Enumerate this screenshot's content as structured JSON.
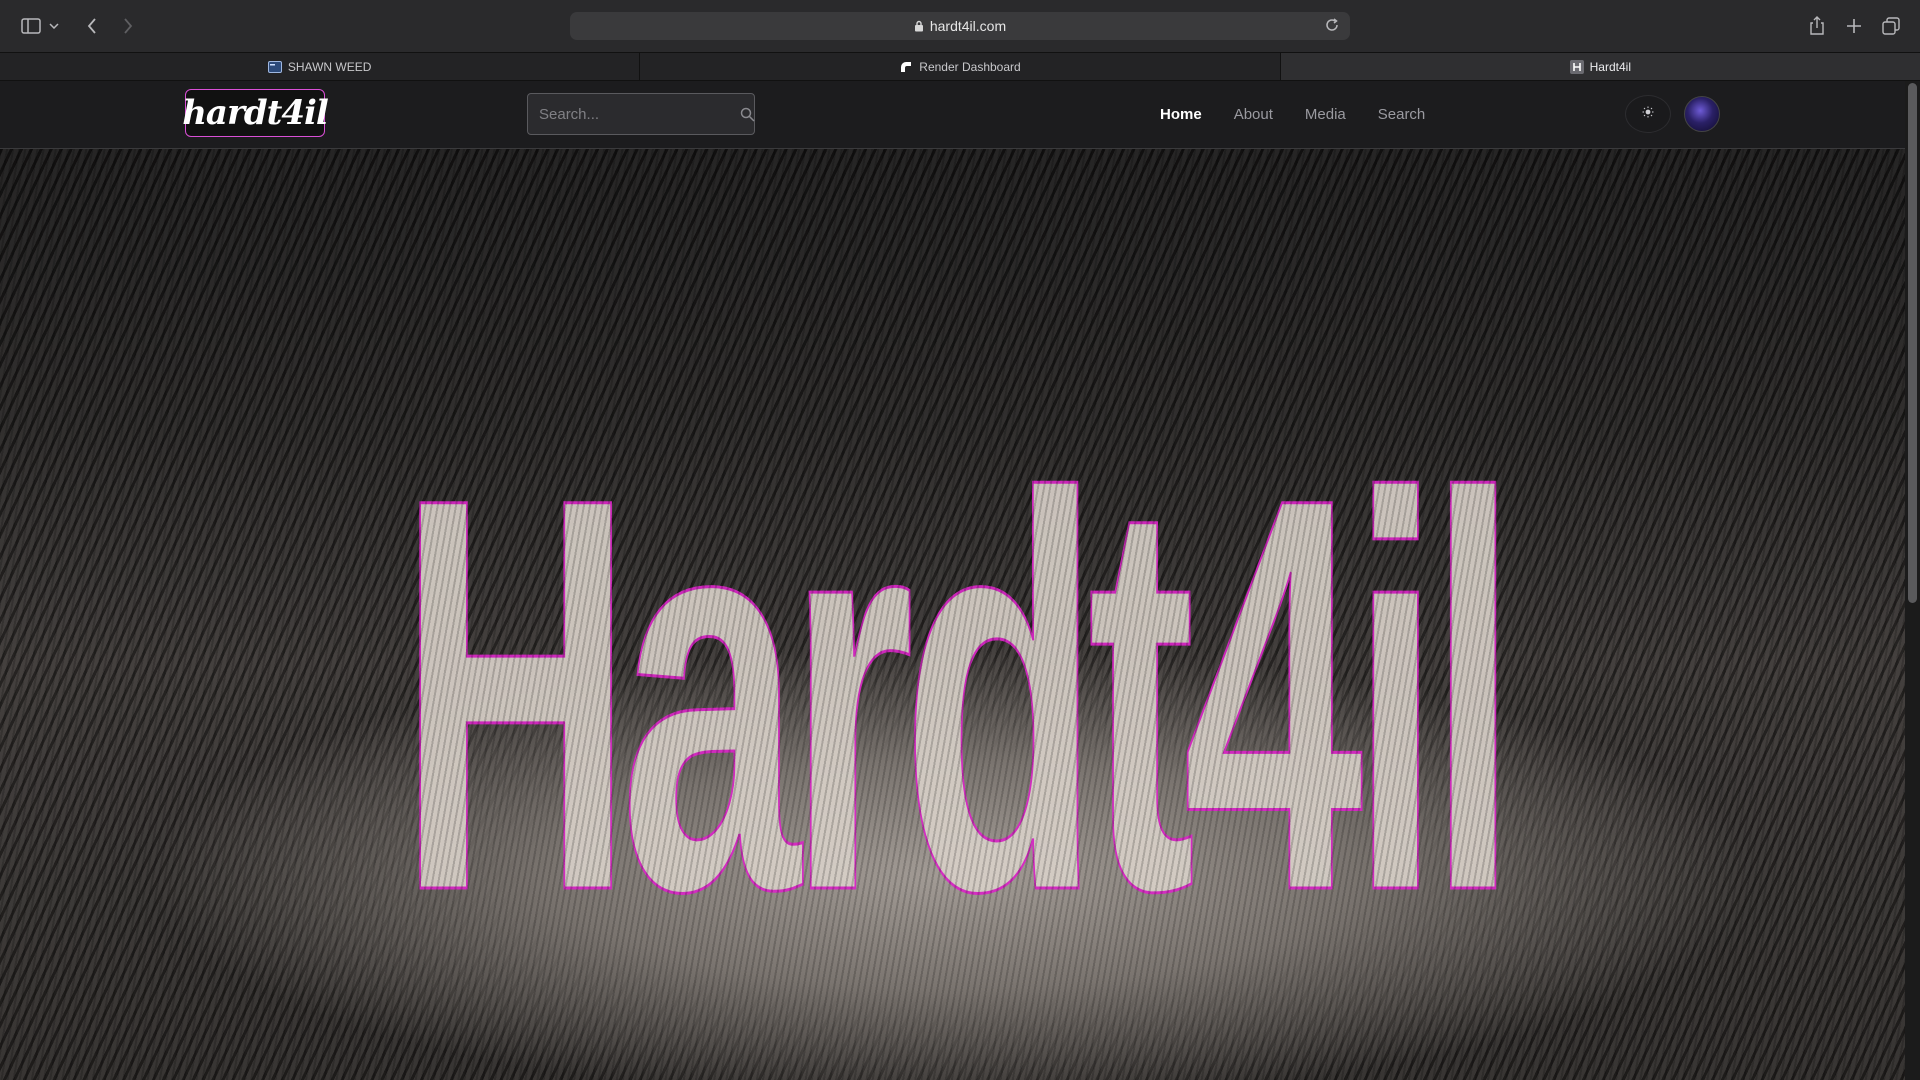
{
  "browser": {
    "url": "hardt4il.com",
    "tabs": [
      {
        "label": "SHAWN WEED",
        "icon": "window-icon",
        "active": false
      },
      {
        "label": "Render Dashboard",
        "icon": "render-icon",
        "active": false
      },
      {
        "label": "Hardt4il",
        "icon": "h-favicon",
        "active": true
      }
    ]
  },
  "site": {
    "logo_text": "hardt4il",
    "search_placeholder": "Search...",
    "nav": [
      {
        "label": "Home",
        "active": true
      },
      {
        "label": "About",
        "active": false
      },
      {
        "label": "Media",
        "active": false
      },
      {
        "label": "Search",
        "active": false
      }
    ],
    "hero_title": "Hardt4il",
    "accent_color": "#d926c6"
  }
}
